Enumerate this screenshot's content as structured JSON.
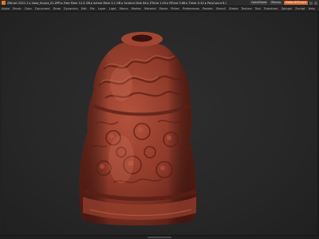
{
  "window": {
    "title": "ZBrush 2021.1 ▸ Vase_Sculpt_01.ZPR ▸ Free Mem 12.4 GB ▸ Active Mem 3.1 GB ▸ Scratch Disk 64 ▸ ZTime 1.05 ▸ RTime 0.88 ▸ Timer 0.42 ▸ PolyCount 8.4 MP ▸ MeshCount 1",
    "quicksave_label": "QuickSave",
    "menus_label": "Menus",
    "default_script_label": "DefaultZScript"
  },
  "menubar": {
    "items": [
      "Alpha",
      "Brush",
      "Color",
      "Document",
      "Draw",
      "Dynamics",
      "Edit",
      "File",
      "Layer",
      "Light",
      "Macro",
      "Marker",
      "Material",
      "Movie",
      "Picker",
      "Preferences",
      "Render",
      "Stencil",
      "Stroke",
      "Texture",
      "Tool",
      "Transform",
      "Zplugin",
      "Zscript",
      "Help"
    ]
  },
  "colors": {
    "clay_base": "#8f3a2a",
    "clay_light": "#b4523c",
    "clay_shadow": "#5a1f16",
    "viewport_bg": "#2a2a2a",
    "accent": "#d9662a"
  },
  "viewport": {
    "subject": "vase-sculpt"
  }
}
